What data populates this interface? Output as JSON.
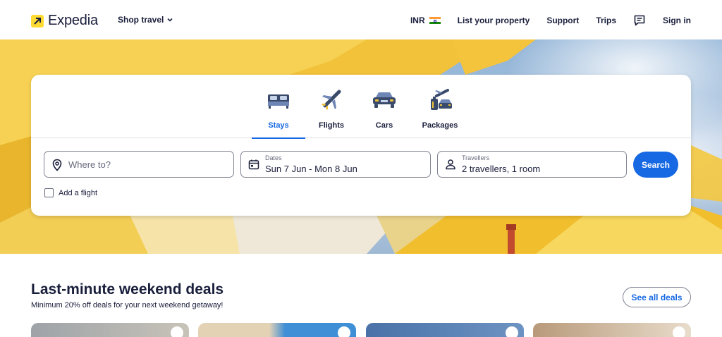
{
  "header": {
    "brand": "Expedia",
    "shop_travel": "Shop travel",
    "currency": "INR",
    "list_property": "List your property",
    "support": "Support",
    "trips": "Trips",
    "sign_in": "Sign in"
  },
  "search": {
    "tabs": [
      {
        "label": "Stays",
        "active": true
      },
      {
        "label": "Flights",
        "active": false
      },
      {
        "label": "Cars",
        "active": false
      },
      {
        "label": "Packages",
        "active": false
      }
    ],
    "destination_placeholder": "Where to?",
    "dates_label": "Dates",
    "dates_value": "Sun 7 Jun - Mon 8 Jun",
    "travellers_label": "Travellers",
    "travellers_value": "2 travellers, 1 room",
    "search_button": "Search",
    "add_flight": "Add a flight"
  },
  "deals": {
    "title": "Last-minute weekend deals",
    "subtitle": "Minimum 20% off deals for your next weekend getaway!",
    "see_all": "See all deals"
  },
  "colors": {
    "accent": "#1668e3",
    "brand_yellow": "#fddb32",
    "text": "#191e3b"
  }
}
